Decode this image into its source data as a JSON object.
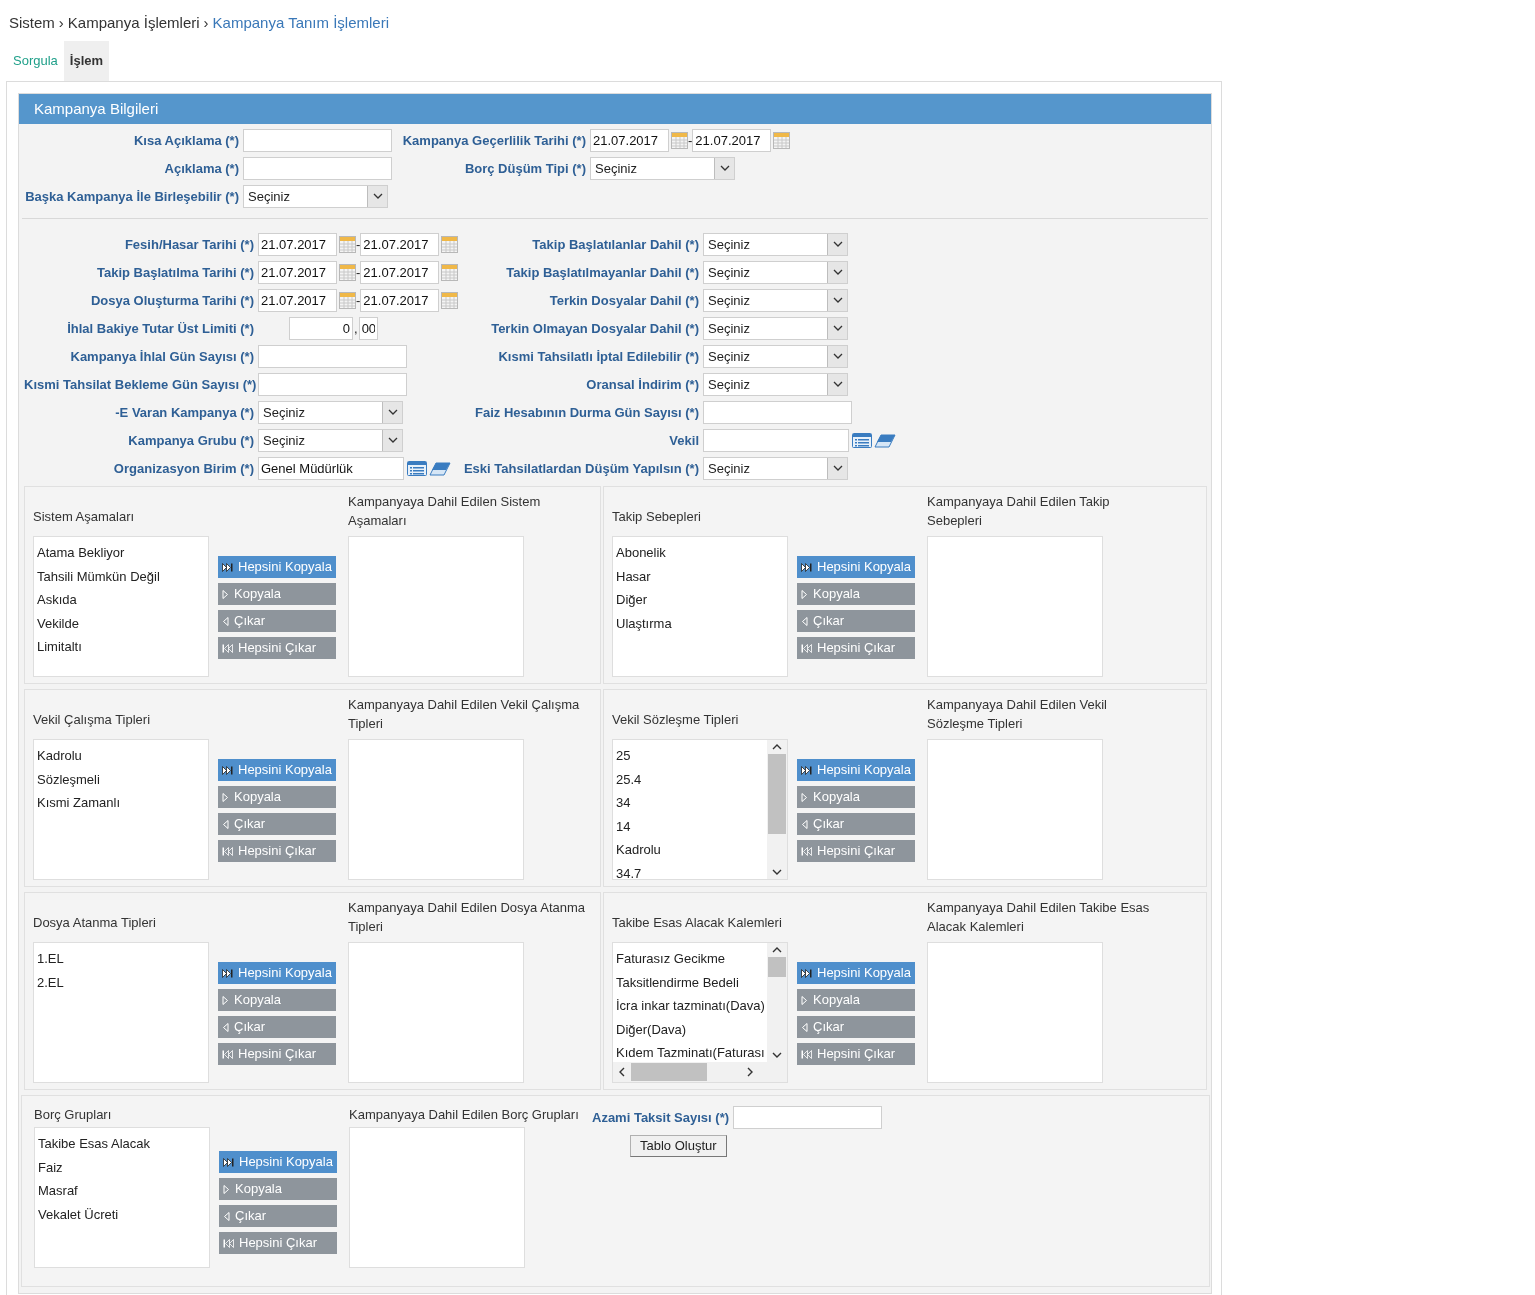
{
  "breadcrumb": [
    {
      "kind": "crumb",
      "text": "Sistem"
    },
    {
      "kind": "separator",
      "text": "›"
    },
    {
      "kind": "crumb",
      "text": "Kampanya İşlemleri"
    },
    {
      "kind": "separator",
      "text": "›"
    },
    {
      "kind": "current",
      "text": "Kampanya Tanım İşlemleri"
    }
  ],
  "tabs": [
    {
      "label": "Sorgula",
      "selected": false
    },
    {
      "label": "İşlem",
      "selected": true
    }
  ],
  "panel": {
    "title": "Kampanya Bilgileri"
  },
  "top_rows": [
    {
      "left": {
        "label": "Kısa Açıklama (*)",
        "kind": "text"
      },
      "right": {
        "label": "Kampanya Geçerlilik Tarihi (*)",
        "kind": "date_range",
        "from": "21.07.2017",
        "separator": "-",
        "to": "21.07.2017"
      }
    },
    {
      "left": {
        "label": "Açıklama (*)",
        "kind": "text"
      },
      "right": {
        "label": "Borç Düşüm Tipi (*)",
        "kind": "select",
        "value": "Seçiniz"
      }
    },
    {
      "left": {
        "label": "Başka Kampanya İle Birleşebilir (*)",
        "kind": "select",
        "value": "Seçiniz"
      }
    }
  ],
  "filter_rows": [
    {
      "left": {
        "label": "Fesih/Hasar Tarihi (*)",
        "kind": "date_range",
        "from": "21.07.2017",
        "separator": "-",
        "to": "21.07.2017"
      },
      "right": {
        "label": "Takip Başlatılanlar Dahil (*)",
        "kind": "select",
        "value": "Seçiniz"
      }
    },
    {
      "left": {
        "label": "Takip Başlatılma Tarihi (*)",
        "kind": "date_range",
        "from": "21.07.2017",
        "separator": "-",
        "to": "21.07.2017"
      },
      "right": {
        "label": "Takip Başlatılmayanlar Dahil (*)",
        "kind": "select",
        "value": "Seçiniz"
      }
    },
    {
      "left": {
        "label": "Dosya Oluşturma Tarihi (*)",
        "kind": "date_range",
        "from": "21.07.2017",
        "separator": "-",
        "to": "21.07.2017"
      },
      "right": {
        "label": "Terkin Dosyalar Dahil (*)",
        "kind": "select",
        "value": "Seçiniz"
      }
    },
    {
      "left": {
        "label": "İhlal Bakiye Tutar Üst Limiti (*)",
        "kind": "amount",
        "integer": "0",
        "separator": ",",
        "decimal": "00"
      },
      "right": {
        "label": "Terkin Olmayan Dosyalar Dahil (*)",
        "kind": "select",
        "value": "Seçiniz"
      }
    },
    {
      "left": {
        "label": "Kampanya İhlal Gün Sayısı (*)",
        "kind": "text"
      },
      "right": {
        "label": "Kısmi Tahsilatlı İptal Edilebilir (*)",
        "kind": "select",
        "value": "Seçiniz"
      }
    },
    {
      "left": {
        "label": "Kısmi Tahsilat Bekleme Gün Sayısı (*)",
        "kind": "text"
      },
      "right": {
        "label": "Oransal İndirim (*)",
        "kind": "select",
        "value": "Seçiniz"
      }
    },
    {
      "left": {
        "label": "-E Varan Kampanya (*)",
        "kind": "select",
        "value": "Seçiniz"
      },
      "right": {
        "label": "Faiz Hesabının Durma Gün Sayısı (*)",
        "kind": "text"
      }
    },
    {
      "left": {
        "label": "Kampanya Grubu (*)",
        "kind": "select",
        "value": "Seçiniz"
      },
      "right": {
        "label": "Vekil",
        "kind": "lookup"
      }
    },
    {
      "left": {
        "label": "Organizasyon Birim (*)",
        "kind": "lookup",
        "value": "Genel Müdürlük"
      },
      "right": {
        "label": "Eski Tahsilatlardan Düşüm Yapılsın (*)",
        "kind": "select",
        "value": "Seçiniz"
      }
    }
  ],
  "transfer_groups": [
    {
      "kind": "standard",
      "source": {
        "title": "Sistem Aşamaları",
        "items": [
          "Atama Bekliyor",
          "Tahsili Mümkün Değil",
          "Askıda",
          "Vekilde",
          "Limitaltı"
        ]
      },
      "buttons": [
        {
          "kind": "copy_all",
          "label": "Hepsini Kopyala",
          "disabled": false
        },
        {
          "kind": "copy",
          "label": "Kopyala",
          "disabled": true
        },
        {
          "kind": "remove",
          "label": "Çıkar",
          "disabled": true
        },
        {
          "kind": "remove_all",
          "label": "Hepsini Çıkar",
          "disabled": true
        }
      ],
      "target": {
        "title": "Kampanyaya Dahil Edilen Sistem Aşamaları"
      }
    },
    {
      "kind": "standard",
      "source": {
        "title": "Takip Sebepleri",
        "items": [
          "Abonelik",
          "Hasar",
          "Diğer",
          "Ulaştırma"
        ]
      },
      "buttons": [
        {
          "kind": "copy_all",
          "label": "Hepsini Kopyala",
          "disabled": false
        },
        {
          "kind": "copy",
          "label": "Kopyala",
          "disabled": true
        },
        {
          "kind": "remove",
          "label": "Çıkar",
          "disabled": true
        },
        {
          "kind": "remove_all",
          "label": "Hepsini Çıkar",
          "disabled": true
        }
      ],
      "target": {
        "title": "Kampanyaya Dahil Edilen Takip Sebepleri"
      }
    },
    {
      "kind": "standard",
      "source": {
        "title": "Vekil Çalışma Tipleri",
        "items": [
          "Kadrolu",
          "Sözleşmeli",
          "Kısmi Zamanlı"
        ]
      },
      "buttons": [
        {
          "kind": "copy_all",
          "label": "Hepsini Kopyala",
          "disabled": false
        },
        {
          "kind": "copy",
          "label": "Kopyala",
          "disabled": true
        },
        {
          "kind": "remove",
          "label": "Çıkar",
          "disabled": true
        },
        {
          "kind": "remove_all",
          "label": "Hepsini Çıkar",
          "disabled": true
        }
      ],
      "target": {
        "title": "Kampanyaya Dahil Edilen Vekil Çalışma Tipleri"
      }
    },
    {
      "kind": "standard",
      "source": {
        "title": "Vekil Sözleşme Tipleri",
        "vertical_scrollbar": true,
        "items": [
          "25",
          "25.4",
          "34",
          "14",
          "Kadrolu",
          "34.7"
        ]
      },
      "buttons": [
        {
          "kind": "copy_all",
          "label": "Hepsini Kopyala",
          "disabled": false
        },
        {
          "kind": "copy",
          "label": "Kopyala",
          "disabled": true
        },
        {
          "kind": "remove",
          "label": "Çıkar",
          "disabled": true
        },
        {
          "kind": "remove_all",
          "label": "Hepsini Çıkar",
          "disabled": true
        }
      ],
      "target": {
        "title": "Kampanyaya Dahil Edilen Vekil Sözleşme Tipleri"
      }
    },
    {
      "kind": "standard",
      "source": {
        "title": "Dosya Atanma Tipleri",
        "items": [
          "1.EL",
          "2.EL"
        ]
      },
      "buttons": [
        {
          "kind": "copy_all",
          "label": "Hepsini Kopyala",
          "disabled": false
        },
        {
          "kind": "copy",
          "label": "Kopyala",
          "disabled": true
        },
        {
          "kind": "remove",
          "label": "Çıkar",
          "disabled": true
        },
        {
          "kind": "remove_all",
          "label": "Hepsini Çıkar",
          "disabled": true
        }
      ],
      "target": {
        "title": "Kampanyaya Dahil Edilen Dosya Atanma Tipleri"
      }
    },
    {
      "kind": "standard",
      "source": {
        "title": "Takibe Esas Alacak Kalemleri",
        "vertical_scrollbar": true,
        "horizontal_scrollbar": true,
        "items": [
          "Faturasız Gecikme",
          "Taksitlendirme Bedeli",
          "İcra inkar tazminatı(Dava)",
          "Diğer(Dava)",
          "Kıdem Tazminatı(Faturası"
        ]
      },
      "buttons": [
        {
          "kind": "copy_all",
          "label": "Hepsini Kopyala",
          "disabled": false
        },
        {
          "kind": "copy",
          "label": "Kopyala",
          "disabled": true
        },
        {
          "kind": "remove",
          "label": "Çıkar",
          "disabled": true
        },
        {
          "kind": "remove_all",
          "label": "Hepsini Çıkar",
          "disabled": true
        }
      ],
      "target": {
        "title": "Kampanyaya Dahil Edilen Takibe Esas Alacak Kalemleri"
      }
    },
    {
      "kind": "with_table",
      "source": {
        "title": "Borç Grupları",
        "items": [
          "Takibe Esas Alacak",
          "Faiz",
          "Masraf",
          "Vekalet Ücreti"
        ]
      },
      "buttons": [
        {
          "kind": "copy_all",
          "label": "Hepsini Kopyala",
          "disabled": false
        },
        {
          "kind": "copy",
          "label": "Kopyala",
          "disabled": true
        },
        {
          "kind": "remove",
          "label": "Çıkar",
          "disabled": true
        },
        {
          "kind": "remove_all",
          "label": "Hepsini Çıkar",
          "disabled": true
        }
      ],
      "target": {
        "title": "Kampanyaya Dahil Edilen Borç Grupları"
      },
      "extra": {
        "label": "Azami Taksit Sayısı (*)",
        "button": "Tablo Oluştur"
      }
    }
  ]
}
